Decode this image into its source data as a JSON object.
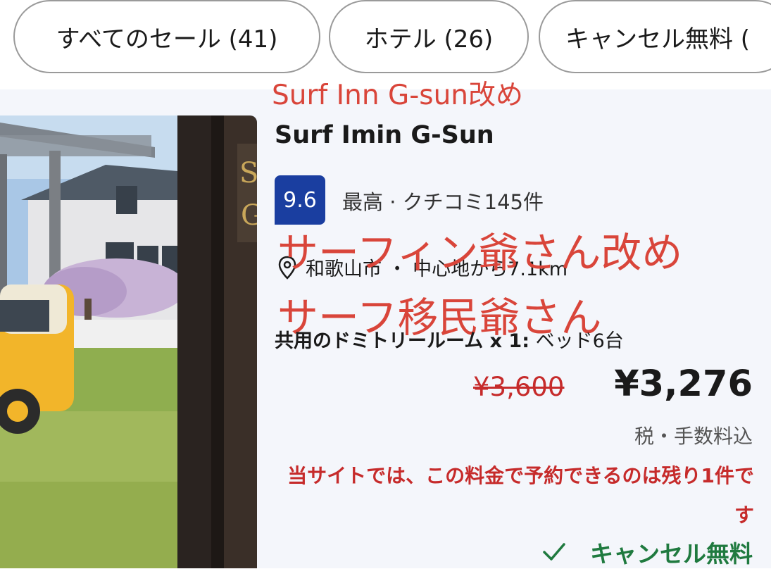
{
  "filters": {
    "all_sales": "すべてのセール (41)",
    "hotels": "ホテル (26)",
    "free_cancel": "キャンセル無料 ("
  },
  "annotations": {
    "line1": "Surf Inn G-sun改め",
    "line2": "サーフィン爺さん改め",
    "line3": "サーフ移民爺さん"
  },
  "listing": {
    "name": "Surf Imin G-Sun",
    "score": "9.6",
    "score_text": "最高 · クチコミ145件",
    "location": "和歌山市 ・ 中心地から7.1km",
    "room_type": "共用のドミトリールーム x 1:",
    "room_detail": " ベッド6台",
    "old_price": "¥3,600",
    "new_price": "¥3,276",
    "tax_note": "税・手数料込",
    "urgency": "当サイトでは、この料金で予約できるのは残り1件です",
    "cancel_label": "キャンセル無料"
  },
  "colors": {
    "score_badge": "#1a3ea0",
    "price_red": "#c62b2b",
    "annotation_red": "#d9453a",
    "cancel_green": "#1f7a3f"
  }
}
